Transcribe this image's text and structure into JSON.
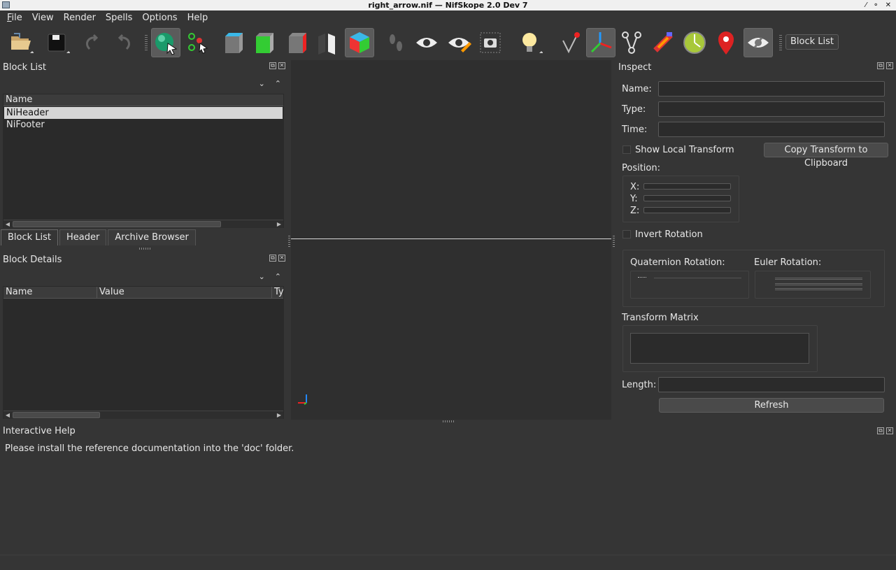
{
  "window": {
    "title": "right_arrow.nif — NifSkope 2.0 Dev 7",
    "controls": "⁄ ⚬ ✕"
  },
  "menu": [
    {
      "first": "F",
      "rest": "ile"
    },
    {
      "first": "",
      "rest": "View"
    },
    {
      "first": "",
      "rest": "Render"
    },
    {
      "first": "",
      "rest": "Spells"
    },
    {
      "first": "",
      "rest": "Options"
    },
    {
      "first": "",
      "rest": "Help"
    }
  ],
  "toolbar": {
    "icons": [
      "open-file-icon",
      "save-file-icon",
      "undo-icon",
      "redo-icon",
      "select-object-icon",
      "select-vertex-icon",
      "view-front-icon",
      "view-top-icon",
      "view-side-icon",
      "view-flip-icon",
      "view-perspective-icon",
      "walk-mode-icon",
      "show-hidden-icon",
      "edit-visibility-icon",
      "screenshot-icon",
      "lighting-icon",
      "show-nodes-icon",
      "show-axes-icon",
      "show-constraints-icon",
      "show-furniture-icon",
      "show-markers-icon",
      "show-collision-icon",
      "show-hidden-toggle-icon"
    ],
    "block_list_label": "Block List"
  },
  "block_list": {
    "title": "Block List",
    "column": "Name",
    "rows": [
      "NiHeader",
      "NiFooter"
    ],
    "selected": 0,
    "tabs": [
      "Block List",
      "Header",
      "Archive Browser"
    ],
    "active_tab": 0
  },
  "block_details": {
    "title": "Block Details",
    "columns": [
      "Name",
      "Value",
      "Ty"
    ]
  },
  "help": {
    "title": "Interactive Help",
    "text": "Please install the reference documentation into the 'doc' folder."
  },
  "inspect": {
    "title": "Inspect",
    "name_label": "Name:",
    "type_label": "Type:",
    "time_label": "Time:",
    "show_local_label": "Show Local Transform",
    "copy_label": "Copy Transform to Clipboard",
    "position_label": "Position:",
    "x_label": "X:",
    "y_label": "Y:",
    "z_label": "Z:",
    "invert_label": "Invert Rotation",
    "quat_label": "Quaternion Rotation:",
    "euler_label": "Euler Rotation:",
    "matrix_label": "Transform Matrix",
    "length_label": "Length:",
    "refresh_label": "Refresh"
  },
  "colors": {
    "background": "#353535",
    "selection": "#d6d6d6"
  }
}
